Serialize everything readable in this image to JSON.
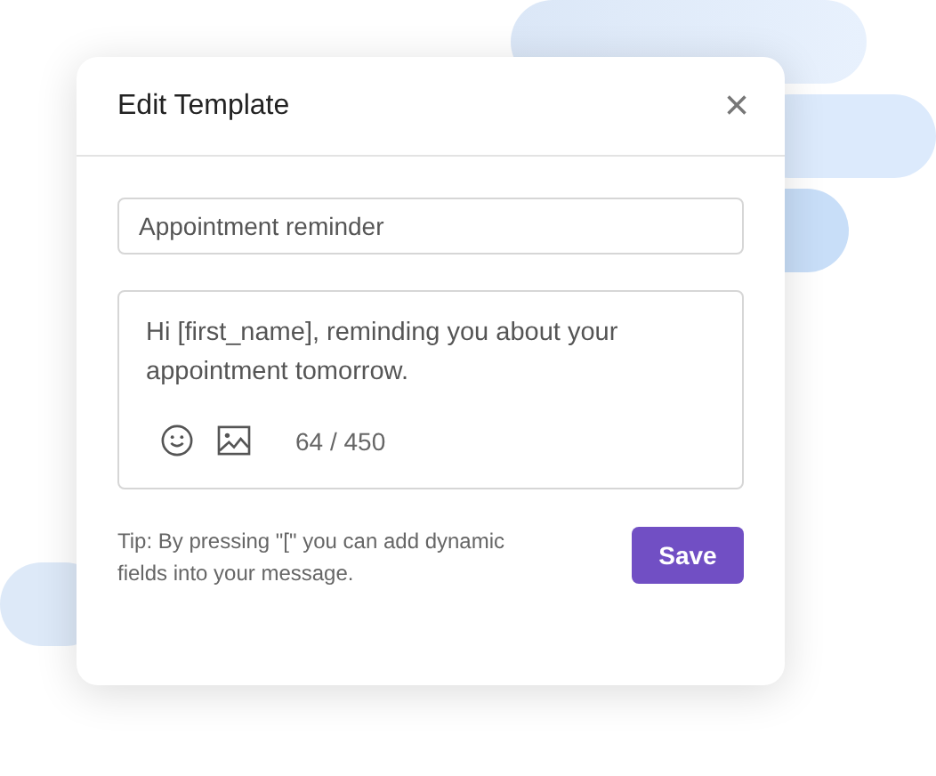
{
  "dialog": {
    "title": "Edit Template",
    "close": "×"
  },
  "template_name": {
    "value": "Appointment reminder"
  },
  "message": {
    "value": "Hi [first_name], reminding you about your appointment tomorrow.",
    "counter": "64 / 450"
  },
  "tip": "Tip: By pressing \"[\" you can add dynamic fields into your message.",
  "buttons": [
    "Save"
  ]
}
